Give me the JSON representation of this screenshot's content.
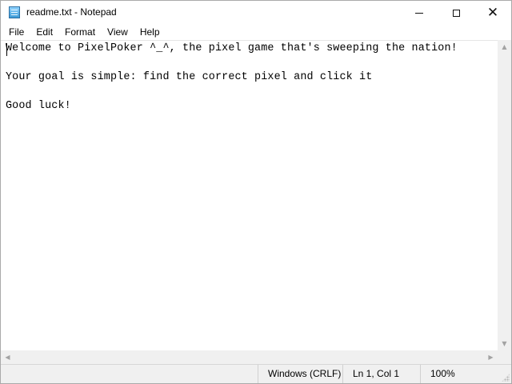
{
  "window": {
    "title": "readme.txt - Notepad",
    "icon": "notepad-icon",
    "controls": {
      "minimize": "minimize-icon",
      "maximize": "maximize-icon",
      "close": "close-icon",
      "close_glyph": "✕"
    }
  },
  "menu": {
    "items": [
      {
        "label": "File"
      },
      {
        "label": "Edit"
      },
      {
        "label": "Format"
      },
      {
        "label": "View"
      },
      {
        "label": "Help"
      }
    ]
  },
  "editor": {
    "lines": [
      "Welcome to PixelPoker ^_^, the pixel game that's sweeping the nation!",
      "Your goal is simple: find the correct pixel and click it",
      "Good luck!"
    ]
  },
  "scrollbars": {
    "up_glyph": "▲",
    "down_glyph": "▼",
    "left_glyph": "◀",
    "right_glyph": "▶"
  },
  "status": {
    "encoding": "Windows (CRLF)",
    "position": "Ln 1, Col 1",
    "zoom": "100%"
  }
}
